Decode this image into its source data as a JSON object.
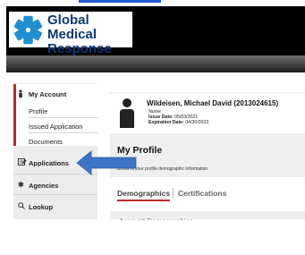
{
  "brand": {
    "name_line1": "Global Medical",
    "name_line2": "Response",
    "logo_color": "#1f8fd1",
    "text_color": "#0d3a73"
  },
  "sidebar": {
    "items": [
      {
        "label": "My Account",
        "icon": "person-icon"
      },
      {
        "label": "Profile"
      },
      {
        "label": "Issued Application"
      },
      {
        "label": "Documents"
      },
      {
        "label": "Applications",
        "icon": "application-icon"
      },
      {
        "label": "Agencies",
        "icon": "gear-icon"
      },
      {
        "label": "Lookup",
        "icon": "search-icon"
      }
    ],
    "active_accent": "#c1272d"
  },
  "profile": {
    "name": "Wildeisen, Michael David (2013024615)",
    "role": "Nurse",
    "issue_label": "Issue Date:",
    "issue_date": "05/03/2021",
    "expiration_label": "Expiration Date:",
    "expiration_date": "04/30/2023"
  },
  "main": {
    "title": "My Profile",
    "subtitle": "Below is your profile demographic information",
    "tabs": [
      {
        "label": "Demographics",
        "active": true
      },
      {
        "label": "Certifications",
        "active": false
      }
    ],
    "section_heading": "Account Demographics"
  },
  "annotation": {
    "arrow_color": "#3f73c6",
    "arrow_icon": "left-arrow-icon"
  }
}
